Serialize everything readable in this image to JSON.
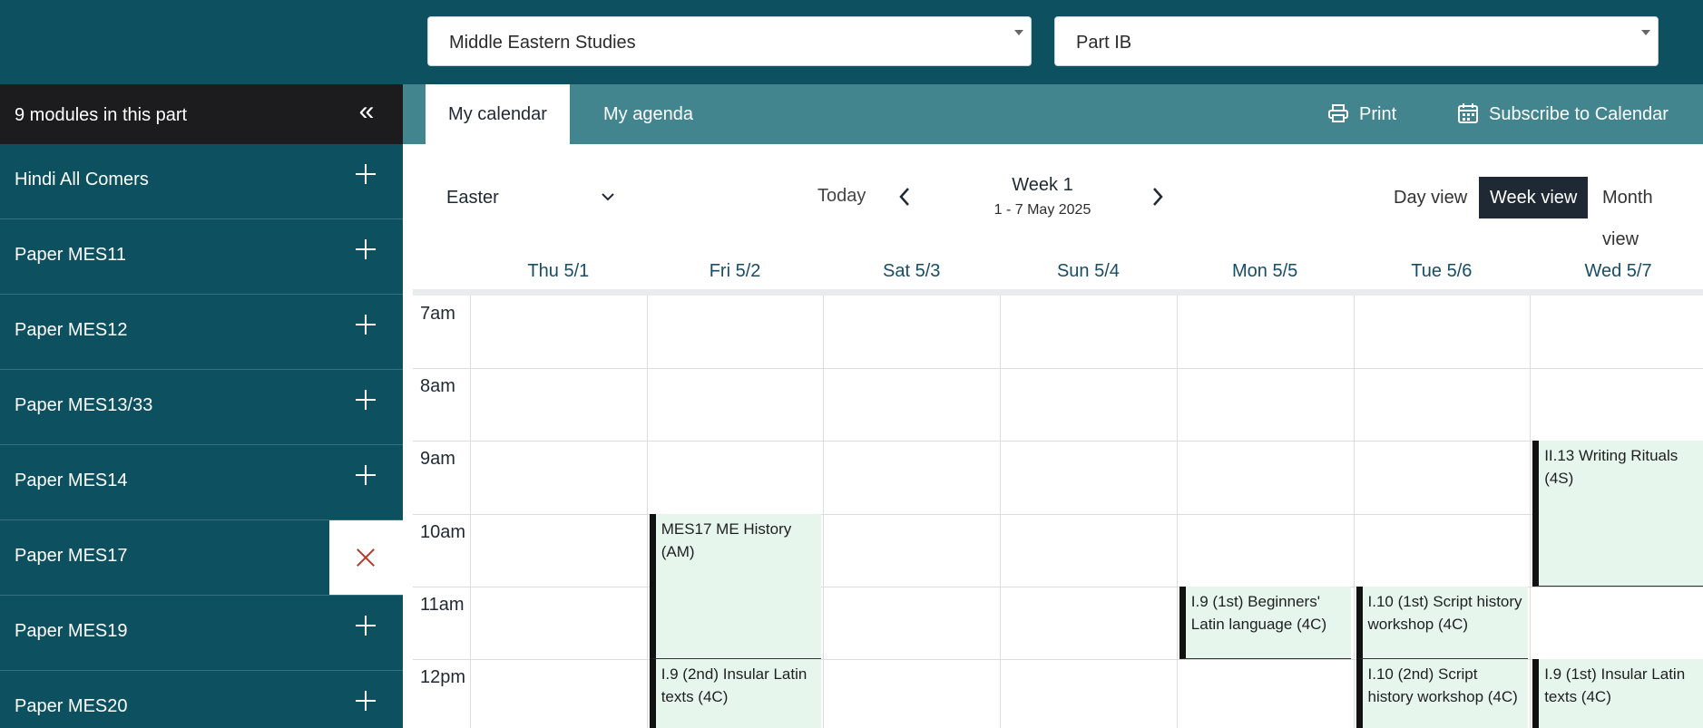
{
  "filters": {
    "subject": "Middle Eastern Studies",
    "part": "Part IB"
  },
  "sidebar": {
    "title": "9 modules in this part",
    "collapse_icon": "double-chevron-left-icon",
    "items": [
      {
        "label": "Hindi All Comers"
      },
      {
        "label": "Paper MES11"
      },
      {
        "label": "Paper MES12"
      },
      {
        "label": "Paper MES13/33"
      },
      {
        "label": "Paper MES14"
      },
      {
        "label": "Paper MES17",
        "selected": true
      },
      {
        "label": "Paper MES19"
      },
      {
        "label": "Paper MES20"
      }
    ]
  },
  "tabs": {
    "calendar": "My calendar",
    "agenda": "My agenda",
    "print": "Print",
    "subscribe": "Subscribe to Calendar"
  },
  "controls": {
    "term": "Easter",
    "today": "Today",
    "week_title": "Week 1",
    "week_range": "1 - 7 May 2025",
    "views": {
      "day": "Day view",
      "week": "Week view",
      "month": "Month view"
    },
    "active_view": "week"
  },
  "calendar": {
    "days": [
      "Thu 5/1",
      "Fri 5/2",
      "Sat 5/3",
      "Sun 5/4",
      "Mon 5/5",
      "Tue 5/6",
      "Wed 5/7"
    ],
    "hours": [
      "7am",
      "8am",
      "9am",
      "10am",
      "11am",
      "12pm"
    ],
    "events": [
      {
        "title": "MES17 ME History (AM)",
        "day": "Fri 5/2",
        "start": "10am",
        "end": "12pm"
      },
      {
        "title": "I.9 (2nd) Insular Latin texts (4C)",
        "day": "Fri 5/2",
        "start": "12pm",
        "end": "1pm"
      },
      {
        "title": "I.9 (1st) Beginners' Latin language (4C)",
        "day": "Mon 5/5",
        "start": "11am",
        "end": "12pm"
      },
      {
        "title": "I.10 (1st) Script history workshop (4C)",
        "day": "Tue 5/6",
        "start": "11am",
        "end": "12pm"
      },
      {
        "title": "I.10 (2nd) Script history workshop (4C)",
        "day": "Tue 5/6",
        "start": "12pm",
        "end": "1pm"
      },
      {
        "title": "II.13 Writing Rituals (4S)",
        "day": "Wed 5/7",
        "start": "9am",
        "end": "11am"
      },
      {
        "title": "I.9 (1st) Insular Latin texts (4C)",
        "day": "Wed 5/7",
        "start": "12pm",
        "end": "1pm"
      }
    ]
  },
  "colors": {
    "header_bg": "#0d5060",
    "tabbar_bg": "#43858f",
    "event_bg": "#e6f6ed",
    "active_view_bg": "#1f2933"
  }
}
